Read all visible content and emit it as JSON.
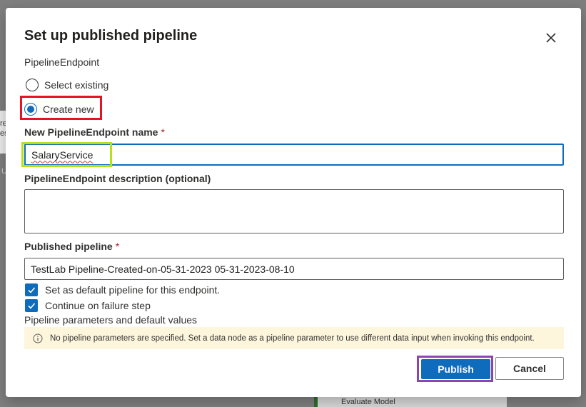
{
  "dialog": {
    "title": "Set up published pipeline",
    "section_label": "PipelineEndpoint",
    "radio_options": [
      {
        "label": "Select existing",
        "checked": false
      },
      {
        "label": "Create new",
        "checked": true
      }
    ],
    "name_field": {
      "label": "New PipelineEndpoint name",
      "required_mark": "*",
      "value": "SalaryService"
    },
    "description_field": {
      "label": "PipelineEndpoint description (optional)",
      "value": ""
    },
    "pipeline_field": {
      "label": "Published pipeline",
      "required_mark": "*",
      "value": "TestLab Pipeline-Created-on-05-31-2023 05-31-2023-08-10"
    },
    "checkboxes": [
      {
        "label": "Set as default pipeline for this endpoint.",
        "checked": true
      },
      {
        "label": "Continue on failure step",
        "checked": true
      }
    ],
    "params_label": "Pipeline parameters and default values",
    "info_message": "No pipeline parameters are specified. Set a data node as a pipeline parameter to use different data input when invoking this endpoint.",
    "buttons": {
      "publish": "Publish",
      "cancel": "Cancel"
    },
    "colors": {
      "primary": "#0f6cbd",
      "highlight_red": "#e81123",
      "highlight_lime": "#b6e01a",
      "highlight_purple": "#8e44ad",
      "info_bg": "#fdf6dd"
    }
  },
  "background": {
    "fragments": [
      "re",
      "es",
      "U"
    ],
    "node_label": "Evaluate Model"
  },
  "icons": {
    "close": "close-icon",
    "info": "info-icon",
    "check": "checkmark-icon"
  }
}
